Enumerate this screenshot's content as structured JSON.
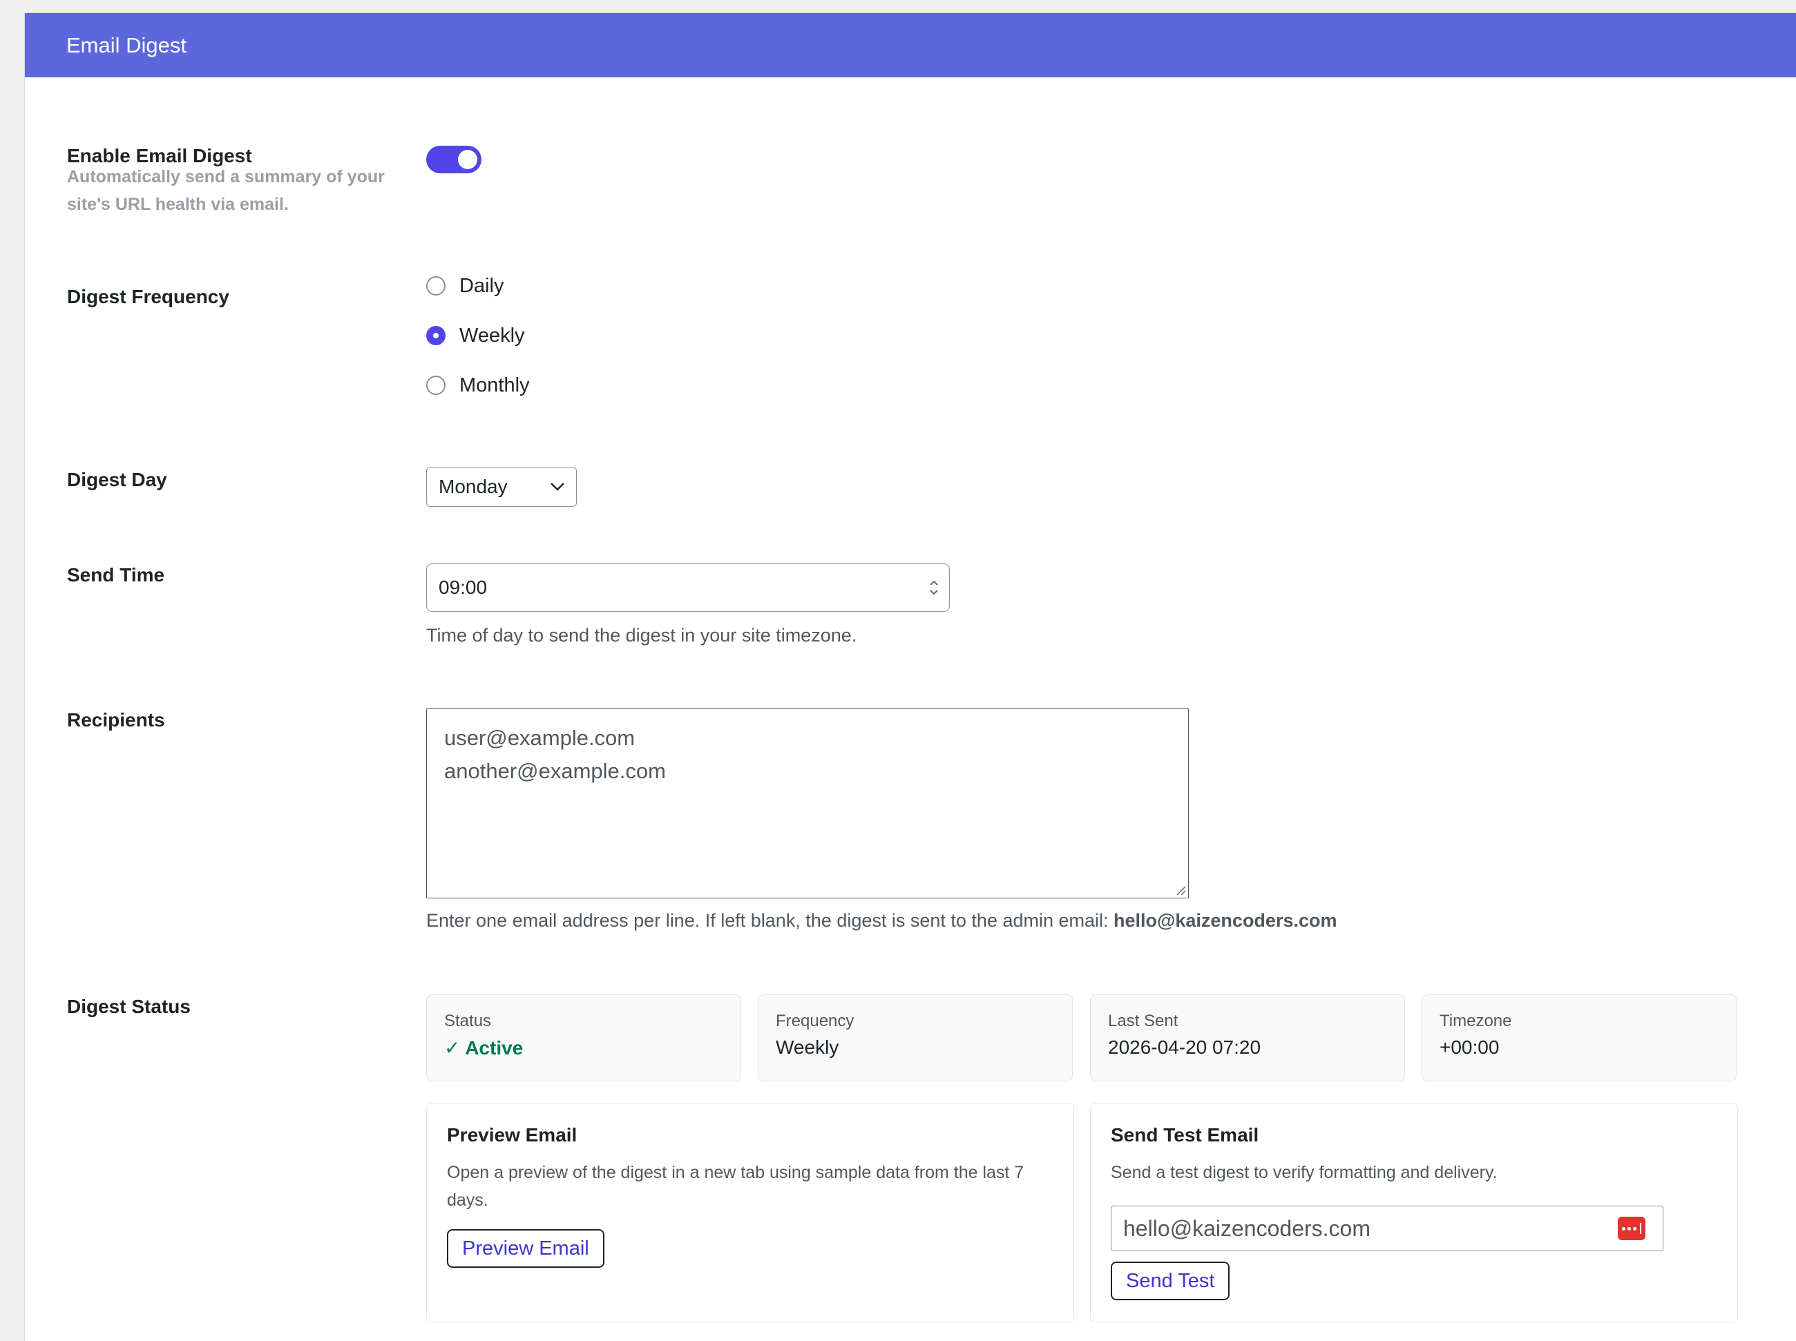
{
  "header": {
    "title": "Email Digest"
  },
  "enable": {
    "label": "Enable Email Digest",
    "description": "Automatically send a summary of your site's URL health via email.",
    "enabled": true
  },
  "frequency": {
    "label": "Digest Frequency",
    "options": [
      {
        "label": "Daily",
        "checked": false
      },
      {
        "label": "Weekly",
        "checked": true
      },
      {
        "label": "Monthly",
        "checked": false
      }
    ]
  },
  "day": {
    "label": "Digest Day",
    "value": "Monday"
  },
  "time": {
    "label": "Send Time",
    "value": "09:00",
    "help": "Time of day to send the digest in your site timezone."
  },
  "recipients": {
    "label": "Recipients",
    "lines": [
      "user@example.com",
      "another@example.com"
    ],
    "help_prefix": "Enter one email address per line. If left blank, the digest is sent to the admin email:",
    "help_email": "hello@kaizencoders.com"
  },
  "status": {
    "label": "Digest Status",
    "cards": [
      {
        "label": "Status",
        "value": "✓ Active"
      },
      {
        "label": "Frequency",
        "value": "Weekly"
      },
      {
        "label": "Last Sent",
        "value": "2026-04-20 07:20"
      },
      {
        "label": "Timezone",
        "value": "+00:00"
      }
    ]
  },
  "preview": {
    "title": "Preview Email",
    "description": "Open a preview of the digest in a new tab using sample data from the last 7 days.",
    "button": "Preview Email"
  },
  "test": {
    "title": "Send Test Email",
    "description": "Send a test digest to verify formatting and delivery.",
    "email": "hello@kaizencoders.com",
    "button": "Send Test"
  },
  "colors": {
    "accent": "#4f46e5",
    "header": "#5b67da",
    "success": "#007a4a"
  }
}
